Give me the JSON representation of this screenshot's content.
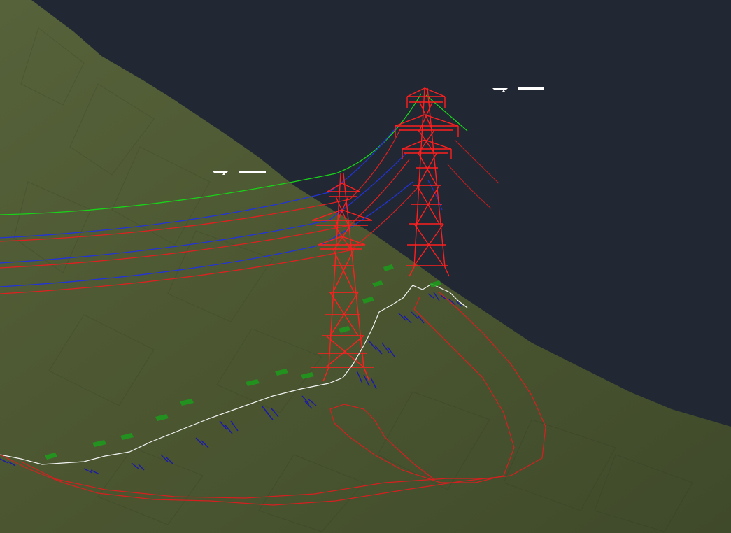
{
  "scene": {
    "view": "3d-viewport",
    "background_color": "#212833",
    "terrain_color": "#4b5630",
    "labels": [
      {
        "id": "tower-a-label",
        "text": ""
      },
      {
        "id": "tower-b-label",
        "text": ""
      }
    ],
    "towers": [
      {
        "id": "tower-a",
        "type": "lattice-transmission-tower",
        "color": "#ff1f1f"
      },
      {
        "id": "tower-b",
        "type": "lattice-transmission-tower",
        "color": "#ff1f1f"
      }
    ],
    "conductors": {
      "earth_wire_color": "#19d319",
      "phase_conductor_colors": [
        "#2233d8",
        "#e02020"
      ]
    },
    "profile_line_color": "#ffffff",
    "boundary_line_color": "#d52020",
    "markers": {
      "blue_color": "#1a1aa8",
      "green_color": "#1c9c1c"
    }
  }
}
